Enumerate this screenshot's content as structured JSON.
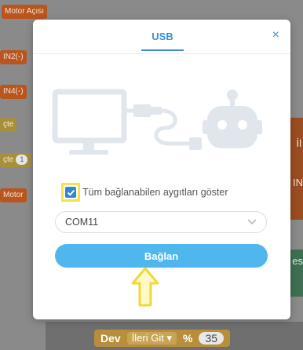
{
  "background": {
    "blocks": [
      {
        "label": "Motor Açısı"
      },
      {
        "label": "IN2(-)"
      },
      {
        "label": "IN4(-)"
      },
      {
        "label": "çte"
      },
      {
        "label": "çte",
        "pill": "1"
      },
      {
        "label": "Motor"
      }
    ],
    "right_letters": [
      "İl",
      "IN",
      "es"
    ],
    "bottom_block": {
      "prefix": "Dev",
      "dropdown": "İleri Git",
      "unit": "%",
      "value": "35"
    }
  },
  "modal": {
    "tab_label": "USB",
    "close_symbol": "×",
    "checkbox_label": "Tüm bağlanabilen aygıtları göster",
    "checkbox_checked": true,
    "port_select": {
      "value": "COM11"
    },
    "connect_label": "Bağlan"
  },
  "colors": {
    "accent": "#3a8fd8",
    "connect_button": "#4fb6ee",
    "highlight": "#f3e14a",
    "illustration": "#e1e6ec"
  },
  "icons": [
    "computer-monitor-icon",
    "usb-cable-icon",
    "robot-head-icon",
    "check-icon",
    "chevron-down-icon",
    "up-arrow-icon"
  ]
}
